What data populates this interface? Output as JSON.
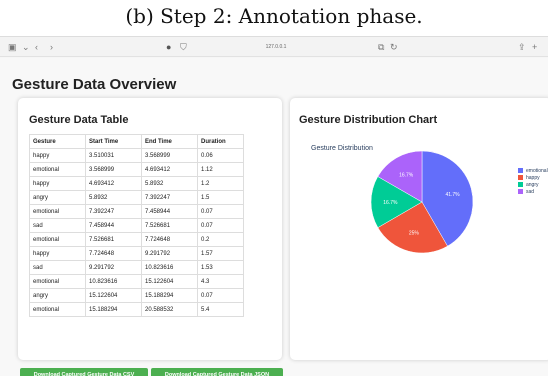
{
  "caption": "(b) Step 2: Annotation phase.",
  "browser": {
    "url": "127.0.0.1"
  },
  "page": {
    "title": "Gesture Data Overview",
    "table": {
      "title": "Gesture Data Table",
      "headers": [
        "Gesture",
        "Start Time",
        "End Time",
        "Duration"
      ],
      "rows": [
        [
          "happy",
          "3.510031",
          "3.568999",
          "0.06"
        ],
        [
          "emotional",
          "3.568999",
          "4.693412",
          "1.12"
        ],
        [
          "happy",
          "4.693412",
          "5.8932",
          "1.2"
        ],
        [
          "angry",
          "5.8932",
          "7.392247",
          "1.5"
        ],
        [
          "emotional",
          "7.392247",
          "7.458944",
          "0.07"
        ],
        [
          "sad",
          "7.458944",
          "7.526681",
          "0.07"
        ],
        [
          "emotional",
          "7.526681",
          "7.724648",
          "0.2"
        ],
        [
          "happy",
          "7.724648",
          "9.291792",
          "1.57"
        ],
        [
          "sad",
          "9.291792",
          "10.823616",
          "1.53"
        ],
        [
          "emotional",
          "10.823616",
          "15.122604",
          "4.3"
        ],
        [
          "angry",
          "15.122604",
          "15.188294",
          "0.07"
        ],
        [
          "emotional",
          "15.188294",
          "20.588532",
          "5.4"
        ]
      ]
    },
    "chart_card": {
      "title": "Gesture Distribution Chart"
    },
    "buttons": {
      "csv": "Download Captured Gesture Data CSV",
      "json": "Download Captured Gesture Data JSON"
    }
  },
  "chart_data": {
    "type": "pie",
    "title": "Gesture Distribution",
    "labels": [
      "emotional",
      "happy",
      "angry",
      "sad"
    ],
    "values": [
      41.7,
      25,
      16.7,
      16.7
    ],
    "value_labels": [
      "41.7%",
      "25%",
      "16.7%",
      "16.7%"
    ],
    "colors": [
      "#636efa",
      "#ef553b",
      "#00cc96",
      "#ab63fa"
    ],
    "legend_position": "right"
  }
}
